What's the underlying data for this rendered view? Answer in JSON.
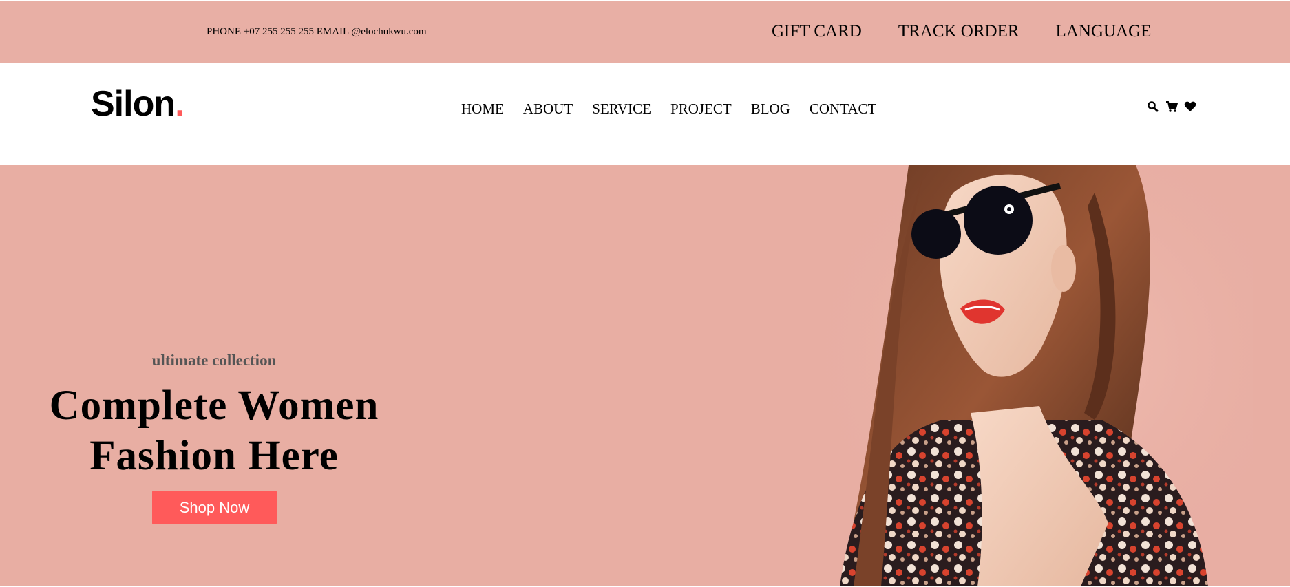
{
  "topbar": {
    "contact_text": "PHONE +07 255 255 255 EMAIL @elochukwu.com",
    "links": [
      "GIFT CARD",
      "TRACK ORDER",
      "LANGUAGE"
    ]
  },
  "navbar": {
    "logo_text": "Silon",
    "logo_dot": ".",
    "links": [
      "HOME",
      "ABOUT",
      "SERVICE",
      "PROJECT",
      "BLOG",
      "CONTACT"
    ],
    "icons": [
      "search-icon",
      "cart-icon",
      "heart-icon"
    ]
  },
  "hero": {
    "subtitle": "ultimate collection",
    "headline_line1": "Complete Women",
    "headline_line2": "Fashion Here",
    "button_label": "Shop Now"
  },
  "colors": {
    "topbar_bg": "#e8afa5",
    "hero_bg": "#e8aea3",
    "accent": "#ff5a5a"
  }
}
